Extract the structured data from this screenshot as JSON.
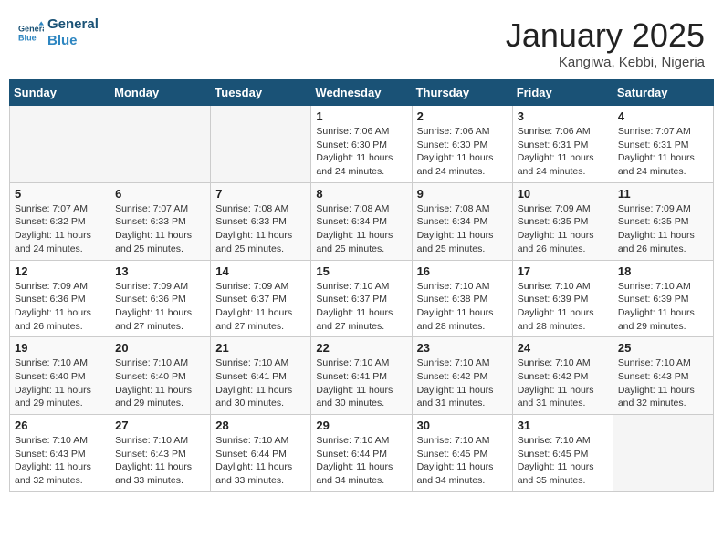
{
  "header": {
    "logo_line1": "General",
    "logo_line2": "Blue",
    "month": "January 2025",
    "location": "Kangiwa, Kebbi, Nigeria"
  },
  "weekdays": [
    "Sunday",
    "Monday",
    "Tuesday",
    "Wednesday",
    "Thursday",
    "Friday",
    "Saturday"
  ],
  "weeks": [
    [
      {
        "day": "",
        "info": ""
      },
      {
        "day": "",
        "info": ""
      },
      {
        "day": "",
        "info": ""
      },
      {
        "day": "1",
        "info": "Sunrise: 7:06 AM\nSunset: 6:30 PM\nDaylight: 11 hours and 24 minutes."
      },
      {
        "day": "2",
        "info": "Sunrise: 7:06 AM\nSunset: 6:30 PM\nDaylight: 11 hours and 24 minutes."
      },
      {
        "day": "3",
        "info": "Sunrise: 7:06 AM\nSunset: 6:31 PM\nDaylight: 11 hours and 24 minutes."
      },
      {
        "day": "4",
        "info": "Sunrise: 7:07 AM\nSunset: 6:31 PM\nDaylight: 11 hours and 24 minutes."
      }
    ],
    [
      {
        "day": "5",
        "info": "Sunrise: 7:07 AM\nSunset: 6:32 PM\nDaylight: 11 hours and 24 minutes."
      },
      {
        "day": "6",
        "info": "Sunrise: 7:07 AM\nSunset: 6:33 PM\nDaylight: 11 hours and 25 minutes."
      },
      {
        "day": "7",
        "info": "Sunrise: 7:08 AM\nSunset: 6:33 PM\nDaylight: 11 hours and 25 minutes."
      },
      {
        "day": "8",
        "info": "Sunrise: 7:08 AM\nSunset: 6:34 PM\nDaylight: 11 hours and 25 minutes."
      },
      {
        "day": "9",
        "info": "Sunrise: 7:08 AM\nSunset: 6:34 PM\nDaylight: 11 hours and 25 minutes."
      },
      {
        "day": "10",
        "info": "Sunrise: 7:09 AM\nSunset: 6:35 PM\nDaylight: 11 hours and 26 minutes."
      },
      {
        "day": "11",
        "info": "Sunrise: 7:09 AM\nSunset: 6:35 PM\nDaylight: 11 hours and 26 minutes."
      }
    ],
    [
      {
        "day": "12",
        "info": "Sunrise: 7:09 AM\nSunset: 6:36 PM\nDaylight: 11 hours and 26 minutes."
      },
      {
        "day": "13",
        "info": "Sunrise: 7:09 AM\nSunset: 6:36 PM\nDaylight: 11 hours and 27 minutes."
      },
      {
        "day": "14",
        "info": "Sunrise: 7:09 AM\nSunset: 6:37 PM\nDaylight: 11 hours and 27 minutes."
      },
      {
        "day": "15",
        "info": "Sunrise: 7:10 AM\nSunset: 6:37 PM\nDaylight: 11 hours and 27 minutes."
      },
      {
        "day": "16",
        "info": "Sunrise: 7:10 AM\nSunset: 6:38 PM\nDaylight: 11 hours and 28 minutes."
      },
      {
        "day": "17",
        "info": "Sunrise: 7:10 AM\nSunset: 6:39 PM\nDaylight: 11 hours and 28 minutes."
      },
      {
        "day": "18",
        "info": "Sunrise: 7:10 AM\nSunset: 6:39 PM\nDaylight: 11 hours and 29 minutes."
      }
    ],
    [
      {
        "day": "19",
        "info": "Sunrise: 7:10 AM\nSunset: 6:40 PM\nDaylight: 11 hours and 29 minutes."
      },
      {
        "day": "20",
        "info": "Sunrise: 7:10 AM\nSunset: 6:40 PM\nDaylight: 11 hours and 29 minutes."
      },
      {
        "day": "21",
        "info": "Sunrise: 7:10 AM\nSunset: 6:41 PM\nDaylight: 11 hours and 30 minutes."
      },
      {
        "day": "22",
        "info": "Sunrise: 7:10 AM\nSunset: 6:41 PM\nDaylight: 11 hours and 30 minutes."
      },
      {
        "day": "23",
        "info": "Sunrise: 7:10 AM\nSunset: 6:42 PM\nDaylight: 11 hours and 31 minutes."
      },
      {
        "day": "24",
        "info": "Sunrise: 7:10 AM\nSunset: 6:42 PM\nDaylight: 11 hours and 31 minutes."
      },
      {
        "day": "25",
        "info": "Sunrise: 7:10 AM\nSunset: 6:43 PM\nDaylight: 11 hours and 32 minutes."
      }
    ],
    [
      {
        "day": "26",
        "info": "Sunrise: 7:10 AM\nSunset: 6:43 PM\nDaylight: 11 hours and 32 minutes."
      },
      {
        "day": "27",
        "info": "Sunrise: 7:10 AM\nSunset: 6:43 PM\nDaylight: 11 hours and 33 minutes."
      },
      {
        "day": "28",
        "info": "Sunrise: 7:10 AM\nSunset: 6:44 PM\nDaylight: 11 hours and 33 minutes."
      },
      {
        "day": "29",
        "info": "Sunrise: 7:10 AM\nSunset: 6:44 PM\nDaylight: 11 hours and 34 minutes."
      },
      {
        "day": "30",
        "info": "Sunrise: 7:10 AM\nSunset: 6:45 PM\nDaylight: 11 hours and 34 minutes."
      },
      {
        "day": "31",
        "info": "Sunrise: 7:10 AM\nSunset: 6:45 PM\nDaylight: 11 hours and 35 minutes."
      },
      {
        "day": "",
        "info": ""
      }
    ]
  ]
}
